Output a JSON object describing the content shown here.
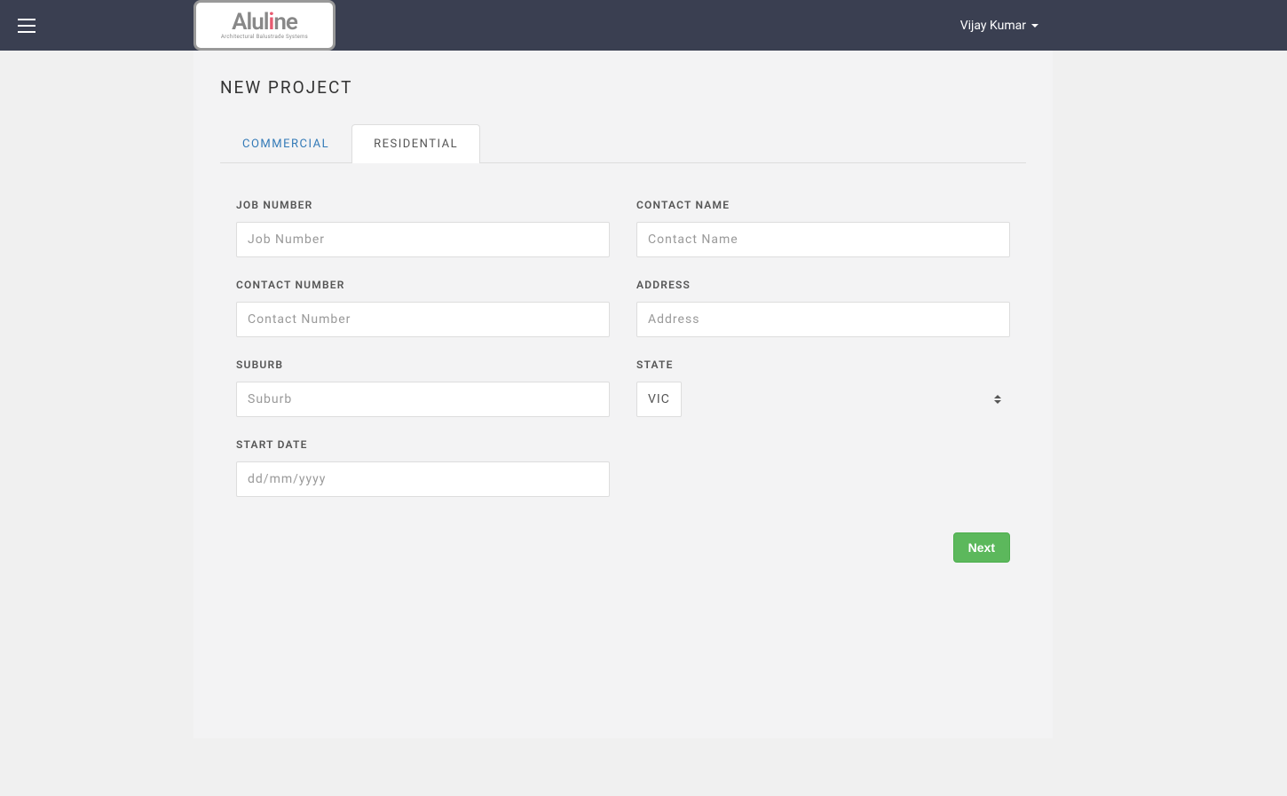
{
  "header": {
    "logo_text": "Aluline",
    "logo_subtitle": "Architectural Balustrade Systems",
    "user_name": "Vijay Kumar"
  },
  "page": {
    "title": "NEW PROJECT"
  },
  "tabs": {
    "commercial": "COMMERCIAL",
    "residential": "RESIDENTIAL"
  },
  "form": {
    "job_number": {
      "label": "JOB NUMBER",
      "placeholder": "Job Number"
    },
    "contact_name": {
      "label": "CONTACT NAME",
      "placeholder": "Contact Name"
    },
    "contact_number": {
      "label": "CONTACT NUMBER",
      "placeholder": "Contact Number"
    },
    "address": {
      "label": "ADDRESS",
      "placeholder": "Address"
    },
    "suburb": {
      "label": "SUBURB",
      "placeholder": "Suburb"
    },
    "state": {
      "label": "STATE",
      "value": "VIC"
    },
    "start_date": {
      "label": "START DATE",
      "placeholder": "dd/mm/yyyy"
    }
  },
  "actions": {
    "next": "Next"
  }
}
